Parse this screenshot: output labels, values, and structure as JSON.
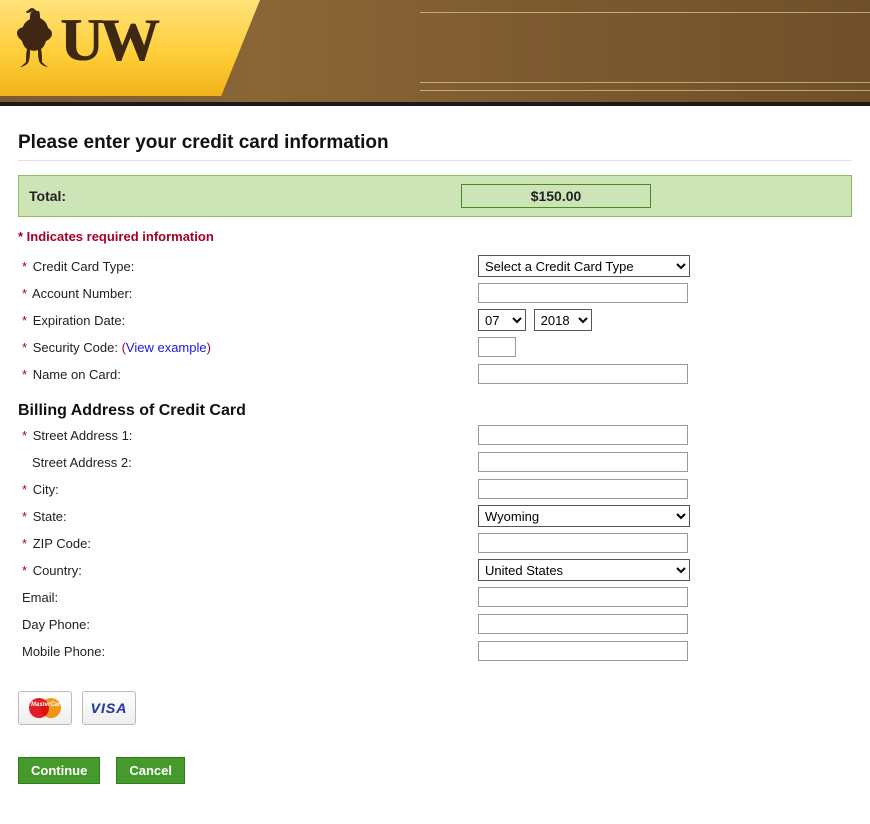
{
  "brand": {
    "uw_text": "UW"
  },
  "page": {
    "title": "Please enter your credit card information",
    "total_label": "Total:",
    "total_amount": "$150.00",
    "required_note": "* Indicates required information"
  },
  "form": {
    "credit_card_type_label": "Credit Card Type:",
    "credit_card_type_value": "Select a Credit Card Type",
    "account_number_label": "Account Number:",
    "account_number_value": "",
    "expiration_label": "Expiration Date:",
    "exp_month": "07",
    "exp_year": "2018",
    "security_code_label_prefix": "Security Code: ",
    "security_code_link": "View example",
    "security_code_value": "",
    "name_on_card_label": "Name on Card:",
    "name_on_card_value": ""
  },
  "billing": {
    "section_title": "Billing Address of Credit Card",
    "street1_label": "Street Address 1:",
    "street1_value": "",
    "street2_label": "Street Address 2:",
    "street2_value": "",
    "city_label": "City:",
    "city_value": "",
    "state_label": "State:",
    "state_value": "Wyoming",
    "zip_label": "ZIP Code:",
    "zip_value": "",
    "country_label": "Country:",
    "country_value": "United States",
    "email_label": "Email:",
    "email_value": "",
    "day_phone_label": "Day Phone:",
    "day_phone_value": "",
    "mobile_phone_label": "Mobile Phone:",
    "mobile_phone_value": ""
  },
  "buttons": {
    "continue": "Continue",
    "cancel": "Cancel"
  },
  "cards": {
    "mastercard": "MasterCard",
    "visa": "VISA"
  }
}
